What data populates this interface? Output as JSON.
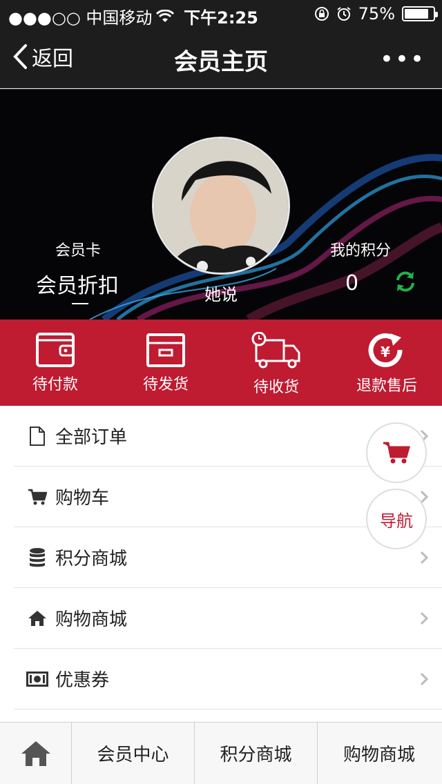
{
  "status_bar": {
    "carrier": "●●●○○ 中国移动",
    "time": "下午2:25",
    "battery": "75%"
  },
  "navbar": {
    "back_label": "返回",
    "title": "会员主页",
    "more": "•••"
  },
  "profile": {
    "name": "她说",
    "card_label": "会员卡",
    "card_value": "会员折扣",
    "points_label": "我的积分",
    "points_value": "0"
  },
  "order_status": [
    {
      "label": "待付款",
      "icon": "wallet-icon"
    },
    {
      "label": "待发货",
      "icon": "box-icon"
    },
    {
      "label": "待收货",
      "icon": "delivery-truck-icon"
    },
    {
      "label": "退款售后",
      "icon": "yen-refund-icon"
    }
  ],
  "menu": [
    {
      "label": "全部订单",
      "icon": "document-icon"
    },
    {
      "label": "购物车",
      "icon": "cart-icon"
    },
    {
      "label": "积分商城",
      "icon": "database-icon"
    },
    {
      "label": "购物商城",
      "icon": "home-icon"
    },
    {
      "label": "优惠券",
      "icon": "money-icon"
    }
  ],
  "floating": {
    "nav_label": "导航"
  },
  "tabbar": [
    {
      "label": "会员中心"
    },
    {
      "label": "积分商城"
    },
    {
      "label": "购物商城"
    }
  ],
  "colors": {
    "accent": "#bf1b31",
    "header_bg": "#1d1d1d",
    "refresh_green": "#22b14c"
  }
}
